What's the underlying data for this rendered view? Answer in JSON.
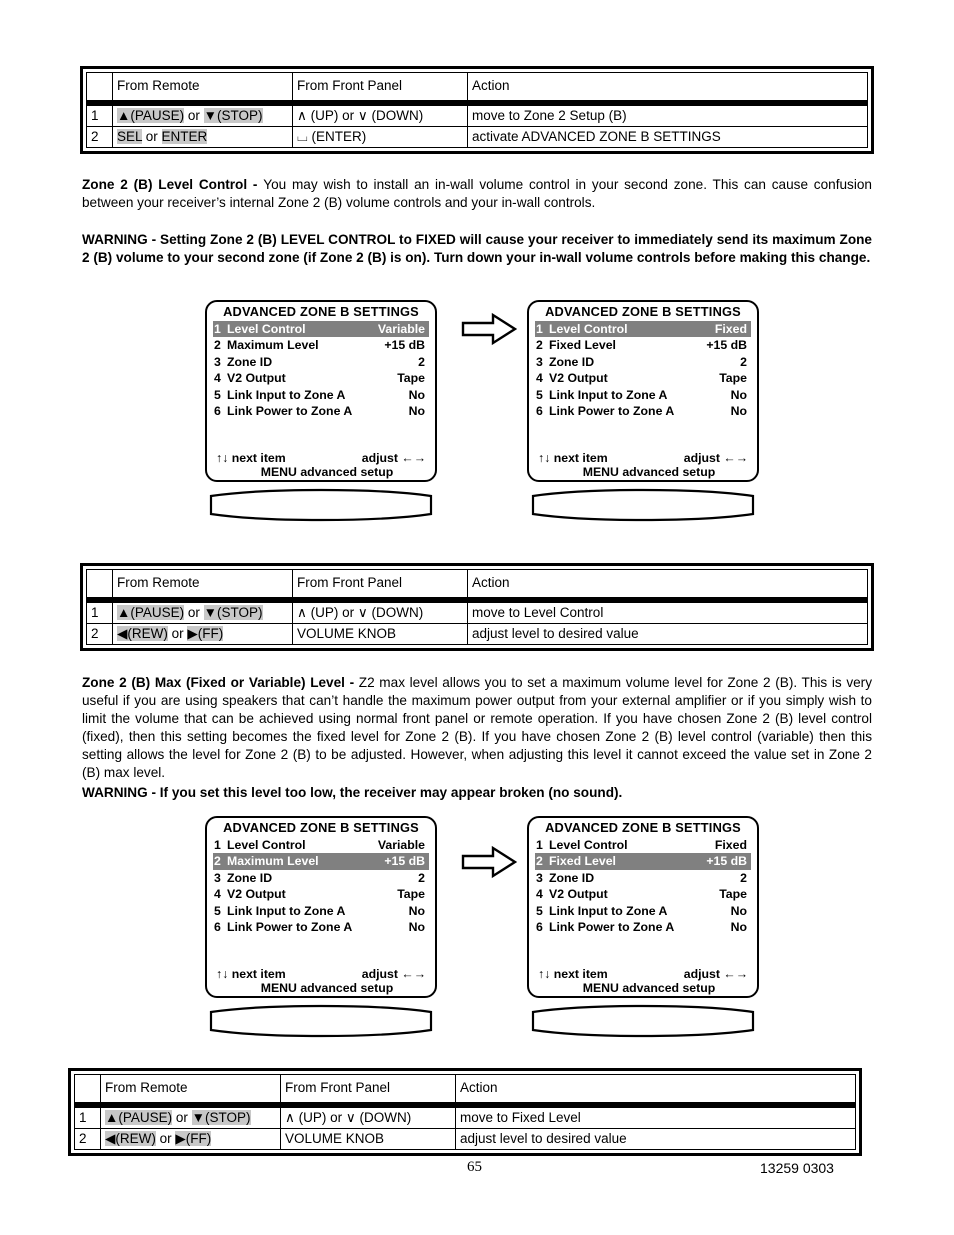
{
  "document": {
    "page_number": "65",
    "doc_code": "13259 0303"
  },
  "table_headers": {
    "num": "",
    "from_remote": "From Remote",
    "from_front_panel": "From Front Panel",
    "action": "Action"
  },
  "tables": [
    {
      "id": "table-zone2-level-control-entry",
      "rows": [
        {
          "num": "1",
          "remote_parts": [
            {
              "text": "▲(PAUSE)",
              "highlight": true
            },
            {
              "text": " or ",
              "highlight": false
            },
            {
              "text": "▼(STOP)",
              "highlight": true
            }
          ],
          "front_panel": "∧ (UP) or ∨ (DOWN)",
          "action": "move to Zone 2 Setup (B)"
        },
        {
          "num": "2",
          "remote_parts": [
            {
              "text": "SEL",
              "highlight": true
            },
            {
              "text": " or ",
              "highlight": false
            },
            {
              "text": "ENTER",
              "highlight": true
            }
          ],
          "front_panel": "⌴ (ENTER)",
          "action": "activate ADVANCED ZONE B SETTINGS"
        }
      ]
    },
    {
      "id": "table-level-control-adjust",
      "rows": [
        {
          "num": "1",
          "remote_parts": [
            {
              "text": "▲(PAUSE)",
              "highlight": true
            },
            {
              "text": " or ",
              "highlight": false
            },
            {
              "text": "▼(STOP)",
              "highlight": true
            }
          ],
          "front_panel": "∧ (UP) or ∨ (DOWN)",
          "action": "move to Level Control"
        },
        {
          "num": "2",
          "remote_parts": [
            {
              "text": "◀(REW)",
              "highlight": true
            },
            {
              "text": " or ",
              "highlight": false
            },
            {
              "text": "▶(FF)",
              "highlight": true
            }
          ],
          "front_panel": "VOLUME KNOB",
          "action": "adjust level to desired value"
        }
      ]
    },
    {
      "id": "table-fixed-level-adjust",
      "rows": [
        {
          "num": "1",
          "remote_parts": [
            {
              "text": "▲(PAUSE)",
              "highlight": true
            },
            {
              "text": " or ",
              "highlight": false
            },
            {
              "text": "▼(STOP)",
              "highlight": true
            }
          ],
          "front_panel": "∧ (UP) or ∨ (DOWN)",
          "action": "move to Fixed Level"
        },
        {
          "num": "2",
          "remote_parts": [
            {
              "text": "◀(REW)",
              "highlight": true
            },
            {
              "text": " or ",
              "highlight": false
            },
            {
              "text": "▶(FF)",
              "highlight": true
            }
          ],
          "front_panel": "VOLUME KNOB",
          "action": "adjust level to desired value"
        }
      ]
    }
  ],
  "sections": {
    "level_control": {
      "heading": "Zone 2 (B) Level Control - ",
      "body": "You may wish to install an in-wall volume control in your second zone. This can cause confusion between your receiver’s internal Zone 2 (B) volume controls and your in-wall controls.",
      "warning": "WARNING - Setting Zone 2 (B) LEVEL CONTROL to FIXED will cause your receiver to immediately send its maximum Zone 2 (B) volume to your second zone (if Zone 2 (B) is on). Turn down your in-wall volume controls before making this change."
    },
    "max_level": {
      "heading": "Zone 2 (B) Max (Fixed or Variable) Level - ",
      "body": "Z2 max level allows you to set a maximum volume level for Zone 2 (B). This is very useful if you are using speakers that can’t handle the maximum power output from your external amplifier or if you simply wish to limit the volume that can be achieved using normal front panel or remote operation. If you have chosen Zone 2 (B) level control (fixed), then this setting becomes the fixed level for Zone 2 (B). If you have chosen Zone 2 (B) level control (variable) then this setting allows the level for Zone 2 (B) to be adjusted. However, when adjusting this level it cannot exceed the value set in Zone 2 (B) max level.",
      "warning": "WARNING - If you set this level too low, the receiver may appear broken (no sound)."
    }
  },
  "lcd_footer": {
    "next_item": "next item",
    "next_item_arrows": "↑↓",
    "adjust": "adjust",
    "adjust_arrows": "←→",
    "menu_line": "MENU advanced setup"
  },
  "panels": [
    {
      "id": "panel-1-variable-level-control",
      "title": "ADVANCED ZONE B SETTINGS",
      "selected_index": 0,
      "items": [
        {
          "num": "1",
          "label": "Level Control",
          "value": "Variable"
        },
        {
          "num": "2",
          "label": "Maximum Level",
          "value": "+15 dB"
        },
        {
          "num": "3",
          "label": "Zone ID",
          "value": "2"
        },
        {
          "num": "4",
          "label": "V2 Output",
          "value": "Tape"
        },
        {
          "num": "5",
          "label": "Link Input  to Zone A",
          "value": "No"
        },
        {
          "num": "6",
          "label": "Link Power to Zone A",
          "value": "No"
        }
      ]
    },
    {
      "id": "panel-2-fixed-level-control",
      "title": "ADVANCED ZONE B SETTINGS",
      "selected_index": 0,
      "items": [
        {
          "num": "1",
          "label": "Level Control",
          "value": "Fixed"
        },
        {
          "num": "2",
          "label": "Fixed Level",
          "value": "+15 dB"
        },
        {
          "num": "3",
          "label": "Zone ID",
          "value": "2"
        },
        {
          "num": "4",
          "label": "V2 Output",
          "value": "Tape"
        },
        {
          "num": "5",
          "label": "Link Input  to Zone A",
          "value": "No"
        },
        {
          "num": "6",
          "label": "Link Power to Zone A",
          "value": "No"
        }
      ]
    },
    {
      "id": "panel-3-maximum-level-selected",
      "title": "ADVANCED ZONE B SETTINGS",
      "selected_index": 1,
      "items": [
        {
          "num": "1",
          "label": "Level Control",
          "value": "Variable"
        },
        {
          "num": "2",
          "label": "Maximum Level",
          "value": "+15 dB"
        },
        {
          "num": "3",
          "label": "Zone ID",
          "value": "2"
        },
        {
          "num": "4",
          "label": "V2 Output",
          "value": "Tape"
        },
        {
          "num": "5",
          "label": "Link Input  to Zone A",
          "value": "No"
        },
        {
          "num": "6",
          "label": "Link Power to Zone A",
          "value": "No"
        }
      ]
    },
    {
      "id": "panel-4-fixed-level-selected",
      "title": "ADVANCED ZONE B SETTINGS",
      "selected_index": 1,
      "items": [
        {
          "num": "1",
          "label": "Level Control",
          "value": "Fixed"
        },
        {
          "num": "2",
          "label": "Fixed Level",
          "value": "+15 dB"
        },
        {
          "num": "3",
          "label": "Zone ID",
          "value": "2"
        },
        {
          "num": "4",
          "label": "V2 Output",
          "value": "Tape"
        },
        {
          "num": "5",
          "label": "Link Input  to Zone A",
          "value": "No"
        },
        {
          "num": "6",
          "label": "Link Power to Zone A",
          "value": "No"
        }
      ]
    }
  ],
  "colors": {
    "selection_background": "#808080",
    "selection_text": "#ffffff",
    "key_highlight": "#c8c8c8",
    "ink": "#000000"
  }
}
